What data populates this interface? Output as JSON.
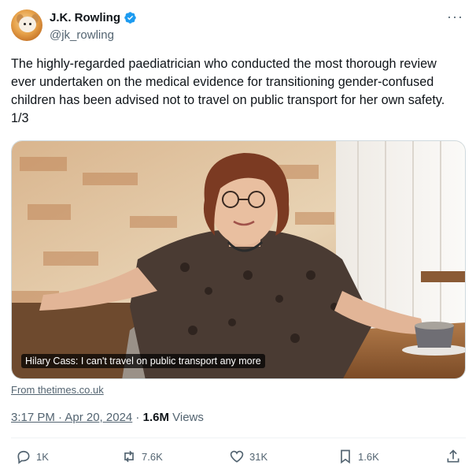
{
  "author": {
    "display_name": "J.K. Rowling",
    "handle": "@jk_rowling",
    "verified_icon": "verified-badge-icon",
    "more_label": "···"
  },
  "tweet": {
    "text": "The highly-regarded paediatrician who conducted the most thorough review ever undertaken on the medical evidence for transitioning gender-confused children has been advised not to travel on public transport for her own safety. 1/3"
  },
  "media": {
    "caption": "Hilary Cass: I can't travel on public transport any more",
    "source": "From thetimes.co.uk"
  },
  "meta": {
    "time": "3:17 PM · Apr 20, 2024",
    "separator": " · ",
    "views_count": "1.6M",
    "views_label": " Views"
  },
  "actions": {
    "replies": "1K",
    "retweets": "7.6K",
    "likes": "31K",
    "bookmarks": "1.6K"
  },
  "colors": {
    "verified": "#1d9bf0",
    "secondary_text": "#536471",
    "primary_text": "#0f1419"
  }
}
